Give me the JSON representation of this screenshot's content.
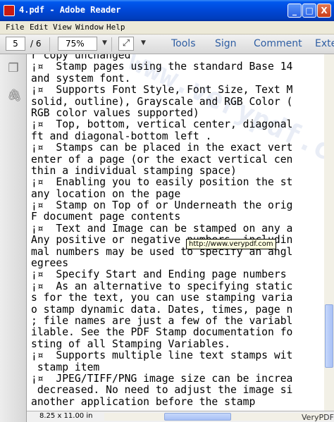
{
  "window": {
    "title": "4.pdf - Adobe Reader",
    "minimize_glyph": "_",
    "maximize_glyph": "□",
    "close_glyph": "X"
  },
  "menu": {
    "items": [
      "File",
      "Edit",
      "View",
      "Window",
      "Help"
    ]
  },
  "toolbar": {
    "page_current": "5",
    "page_total": "/ 6",
    "zoom": "75%",
    "fit_glyph": "⤢",
    "links": [
      "Tools",
      "Sign",
      "Comment",
      "Exte"
    ]
  },
  "nav": {
    "icons": [
      "pages-icon",
      "paperclip-icon"
    ],
    "icon_glyphs": [
      "❐",
      "🖇"
    ]
  },
  "document": {
    "lines": [
      "r copy unchanged",
      "¡¤  Stamp pages using the standard Base 14",
      "and system font.",
      "¡¤  Supports Font Style, Font Size, Text M",
      "solid, outline), Grayscale and RGB Color (",
      "RGB color values supported)",
      "¡¤  Top, bottom, vertical center, diagonal",
      "ft and diagonal-bottom left .",
      "¡¤  Stamps can be placed in the exact vert",
      "enter of a page (or the exact vertical cen",
      "thin a individual stamping space)",
      "¡¤  Enabling you to easily position the st",
      "any location on the page",
      "¡¤  Stamp on Top of or Underneath the orig",
      "F document page contents",
      "¡¤  Text and Image can be stamped on any a",
      "Any positive or negative numbers, includin",
      "mal numbers may be used to specify an angl",
      "egrees",
      "¡¤  Specify Start and Ending page numbers",
      "¡¤  As an alternative to specifying static",
      "s for the text, you can use stamping varia",
      "o stamp dynamic data. Dates, times, page n",
      "; file names are just a few of the variabl",
      "ilable. See the PDF Stamp documentation fo",
      "sting of all Stamping Variables.",
      "¡¤  Supports multiple line text stamps wit",
      " stamp item",
      "¡¤  JPEG/TIFF/PNG image size can be increa",
      " decreased. No need to adjust the image si",
      "another application before the stamp"
    ],
    "tooltip": "http://www.verypdf.com",
    "watermark": "www.verypdf.com"
  },
  "status": {
    "page_size": "8.25 x 11.00 in",
    "credit": "VeryPDF"
  }
}
